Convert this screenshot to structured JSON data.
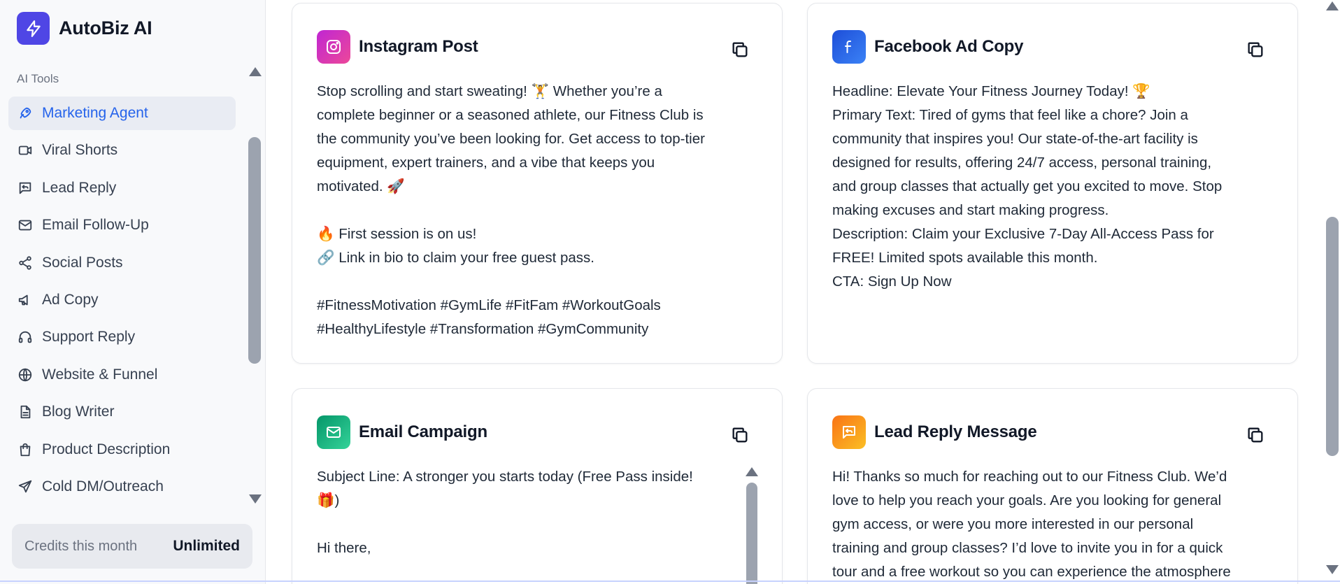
{
  "app": {
    "name": "AutoBiz AI",
    "accent": "#4f46e5"
  },
  "sidebar": {
    "section_label": "AI Tools",
    "items": [
      {
        "label": "Marketing Agent",
        "icon": "rocket-icon",
        "active": true
      },
      {
        "label": "Viral Shorts",
        "icon": "video-icon"
      },
      {
        "label": "Lead Reply",
        "icon": "message-reply-icon"
      },
      {
        "label": "Email Follow-Up",
        "icon": "mail-icon"
      },
      {
        "label": "Social Posts",
        "icon": "share-icon"
      },
      {
        "label": "Ad Copy",
        "icon": "megaphone-icon"
      },
      {
        "label": "Support Reply",
        "icon": "headphones-icon"
      },
      {
        "label": "Website & Funnel",
        "icon": "globe-icon"
      },
      {
        "label": "Blog Writer",
        "icon": "document-icon"
      },
      {
        "label": "Product Description",
        "icon": "shopping-bag-icon"
      },
      {
        "label": "Cold DM/Outreach",
        "icon": "send-icon"
      }
    ],
    "credits": {
      "label": "Credits this month",
      "value": "Unlimited"
    }
  },
  "cards": [
    {
      "title": "Instagram Post",
      "icon": "instagram-icon",
      "icon_color": "#d946ef",
      "body": "Stop scrolling and start sweating! 🏋️ Whether you’re a\ncomplete beginner or a seasoned athlete, our Fitness Club is\nthe community you’ve been looking for. Get access to top-tier\nequipment, expert trainers, and a vibe that keeps you\nmotivated. 🚀\n\n🔥 First session is on us!\n🔗 Link in bio to claim your free guest pass.\n\n#FitnessMotivation #GymLife #FitFam #WorkoutGoals\n#HealthyLifestyle #Transformation #GymCommunity"
    },
    {
      "title": "Facebook Ad Copy",
      "icon": "facebook-icon",
      "icon_color": "#2563eb",
      "body": "Headline: Elevate Your Fitness Journey Today! 🏆\nPrimary Text: Tired of gyms that feel like a chore? Join a\ncommunity that inspires you! Our state-of-the-art facility is\ndesigned for results, offering 24/7 access, personal training,\nand group classes that actually get you excited to move. Stop\nmaking excuses and start making progress.\nDescription: Claim your Exclusive 7-Day All-Access Pass for\nFREE! Limited spots available this month.\nCTA: Sign Up Now"
    },
    {
      "title": "Email Campaign",
      "icon": "mail-icon",
      "icon_color": "#10b981",
      "body": "Subject Line: A stronger you starts today (Free Pass inside!\n🎁)\n\nHi there,"
    },
    {
      "title": "Lead Reply Message",
      "icon": "message-reply-icon",
      "icon_color": "#f59e0b",
      "body": "Hi! Thanks so much for reaching out to our Fitness Club. We’d\nlove to help you reach your goals. Are you looking for general\ngym access, or were you more interested in our personal\ntraining and group classes? I’d love to invite you in for a quick\ntour and a free workout so you can experience the atmosphere"
    }
  ]
}
